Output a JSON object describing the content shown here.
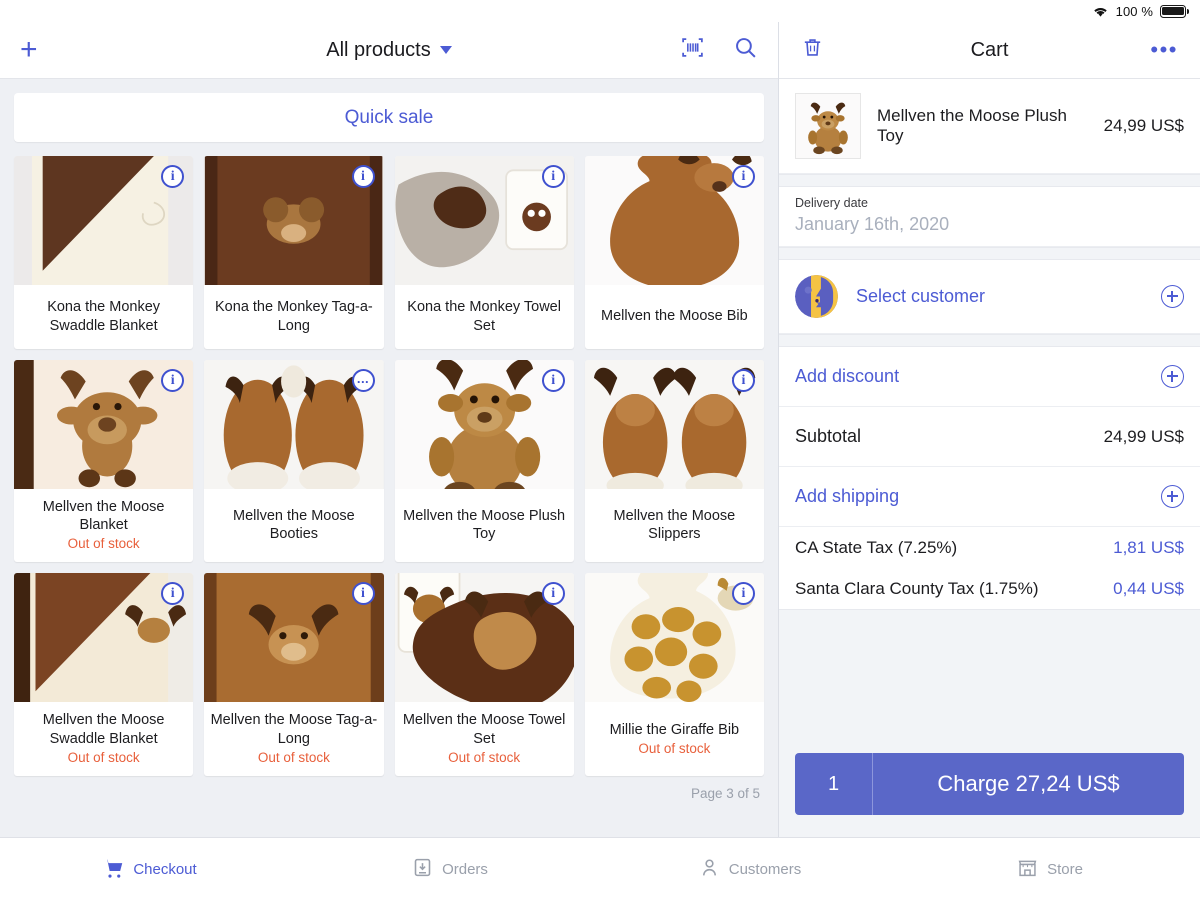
{
  "statusbar": {
    "wifi_icon": "wifi-icon",
    "battery_pct": "100 %",
    "battery_icon": "battery-full-icon"
  },
  "left_header": {
    "add_label": "+",
    "title": "All products",
    "caret_icon": "chevron-down-icon",
    "barcode_icon": "barcode-scan-icon",
    "search_icon": "search-icon"
  },
  "quick_sale": {
    "label": "Quick sale"
  },
  "products": [
    {
      "name": "Kona the Monkey Swaddle Blanket",
      "stock": "",
      "badge": "i",
      "img": "swaddle-brown-cream"
    },
    {
      "name": "Kona the Monkey Tag-a-Long",
      "stock": "",
      "badge": "i",
      "img": "tagalong-brown"
    },
    {
      "name": "Kona the Monkey Towel Set",
      "stock": "",
      "badge": "i",
      "img": "towel-set-grey"
    },
    {
      "name": "Mellven the Moose Bib",
      "stock": "",
      "badge": "i",
      "img": "moose-bib"
    },
    {
      "name": "Mellven the Moose Blanket",
      "stock": "Out of stock",
      "badge": "i",
      "img": "moose-blanket"
    },
    {
      "name": "Mellven the Moose Booties",
      "stock": "",
      "badge": "...",
      "img": "moose-booties"
    },
    {
      "name": "Mellven the Moose Plush Toy",
      "stock": "",
      "badge": "i",
      "img": "moose-plush"
    },
    {
      "name": "Mellven the Moose Slippers",
      "stock": "",
      "badge": "i",
      "img": "moose-slippers"
    },
    {
      "name": "Mellven the Moose Swaddle Blanket",
      "stock": "Out of stock",
      "badge": "i",
      "img": "moose-swaddle"
    },
    {
      "name": "Mellven the Moose Tag-a-Long",
      "stock": "Out of stock",
      "badge": "i",
      "img": "moose-tagalong"
    },
    {
      "name": "Mellven the Moose Towel Set",
      "stock": "Out of stock",
      "badge": "i",
      "img": "moose-towel-set"
    },
    {
      "name": "Millie the Giraffe Bib",
      "stock": "Out of stock",
      "badge": "i",
      "img": "giraffe-bib"
    }
  ],
  "pagination": {
    "label": "Page 3 of 5"
  },
  "cart": {
    "trash_icon": "trash-icon",
    "title": "Cart",
    "more_icon": "more-options-icon",
    "items": [
      {
        "name": "Mellven the Moose Plush Toy",
        "price": "24,99 US$",
        "thumb": "moose-plush"
      }
    ],
    "delivery": {
      "label": "Delivery date",
      "value": "January 16th, 2020"
    },
    "customer": {
      "label": "Select customer",
      "avatar_icon": "customer-avatar-icon",
      "add_icon": "plus-circle-icon"
    },
    "discount": {
      "label": "Add discount",
      "add_icon": "plus-circle-icon"
    },
    "subtotal": {
      "label": "Subtotal",
      "value": "24,99 US$"
    },
    "shipping": {
      "label": "Add shipping",
      "add_icon": "plus-circle-icon"
    },
    "taxes": [
      {
        "label": "CA State Tax (7.25%)",
        "value": "1,81 US$"
      },
      {
        "label": "Santa Clara County Tax (1.75%)",
        "value": "0,44 US$"
      }
    ],
    "charge": {
      "qty": "1",
      "label": "Charge 27,24 US$"
    }
  },
  "tabs": [
    {
      "label": "Checkout",
      "icon": "cart-icon",
      "active": true
    },
    {
      "label": "Orders",
      "icon": "orders-icon",
      "active": false
    },
    {
      "label": "Customers",
      "icon": "customers-icon",
      "active": false
    },
    {
      "label": "Store",
      "icon": "store-icon",
      "active": false
    }
  ],
  "colors": {
    "accent": "#4c5bd4",
    "charge_button": "#5a67c8",
    "out_of_stock": "#e8603c",
    "muted": "#9aa0ab"
  }
}
